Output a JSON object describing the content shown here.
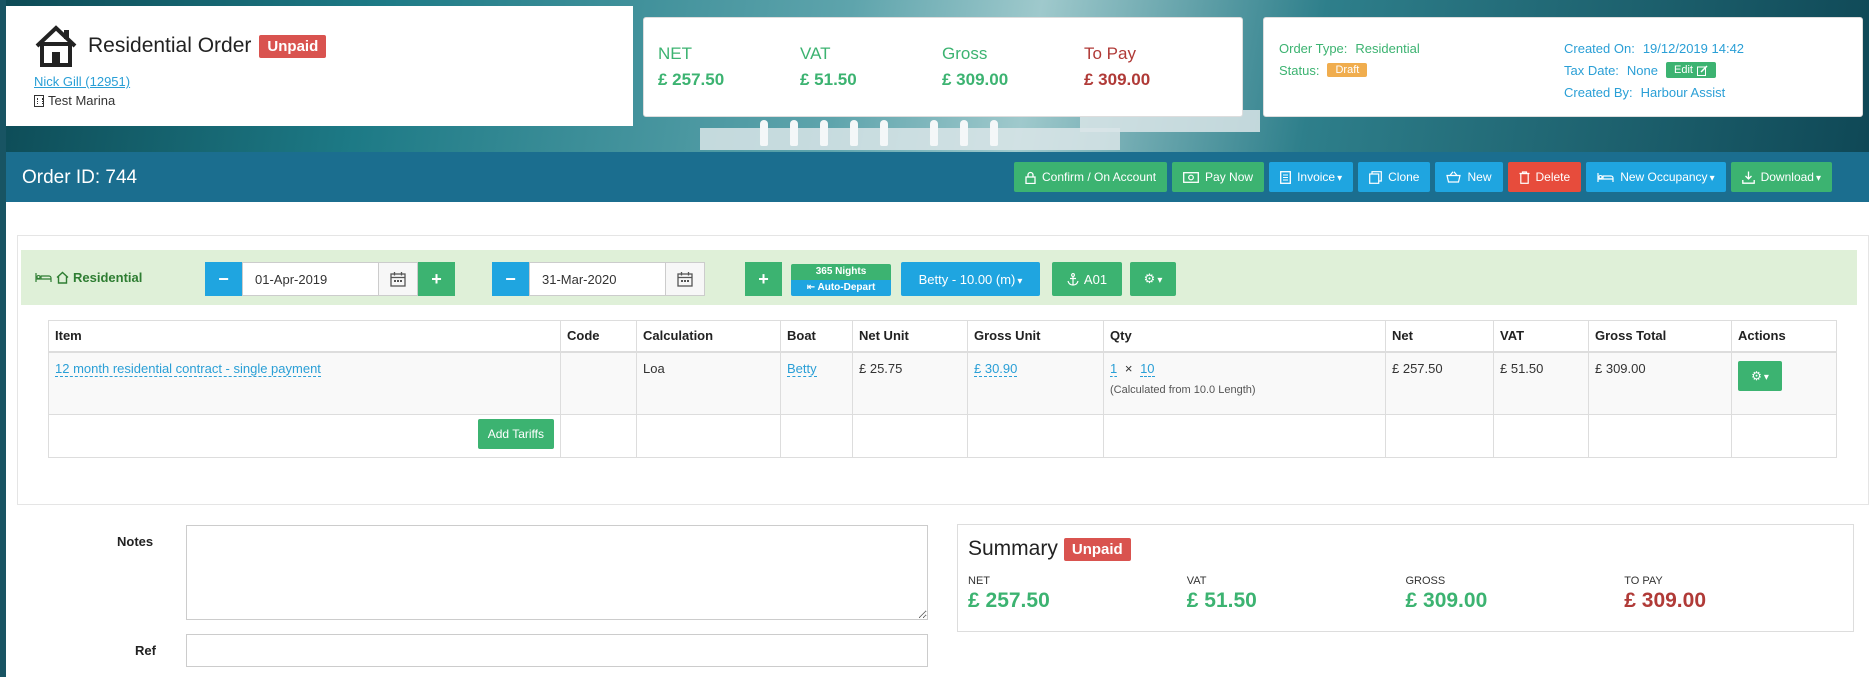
{
  "header": {
    "title": "Residential Order",
    "status_badge": "Unpaid",
    "customer_link": "Nick Gill (12951)",
    "marina": "Test Marina"
  },
  "totals": {
    "net_label": "NET",
    "net_value": "£ 257.50",
    "vat_label": "VAT",
    "vat_value": "£ 51.50",
    "gross_label": "Gross",
    "gross_value": "£ 309.00",
    "topay_label": "To Pay",
    "topay_value": "£ 309.00"
  },
  "meta": {
    "order_type_label": "Order Type:",
    "order_type_value": "Residential",
    "status_label": "Status:",
    "status_value": "Draft",
    "created_on_label": "Created On:",
    "created_on_value": "19/12/2019 14:42",
    "tax_date_label": "Tax Date:",
    "tax_date_value": "None",
    "edit_label": "Edit",
    "created_by_label": "Created By:",
    "created_by_value": "Harbour Assist"
  },
  "order_bar": {
    "order_id": "Order ID: 744",
    "buttons": {
      "confirm": "Confirm / On Account",
      "pay_now": "Pay Now",
      "invoice": "Invoice",
      "clone": "Clone",
      "new": "New",
      "delete": "Delete",
      "new_occupancy": "New Occupancy",
      "download": "Download"
    }
  },
  "booking": {
    "label": "Residential",
    "start_date": "01-Apr-2019",
    "end_date": "31-Mar-2020",
    "nights": "365 Nights",
    "auto_depart": "Auto-Depart",
    "boat_select": "Betty - 10.00 (m)",
    "berth": "A01"
  },
  "table": {
    "headers": [
      "Item",
      "Code",
      "Calculation",
      "Boat",
      "Net Unit",
      "Gross Unit",
      "Qty",
      "Net",
      "VAT",
      "Gross Total",
      "Actions"
    ],
    "rows": [
      {
        "item": "12 month residential contract - single payment",
        "code": "",
        "calculation": "Loa",
        "boat": "Betty",
        "net_unit": "£ 25.75",
        "gross_unit": "£ 30.90",
        "qty_a": "1",
        "qty_x": "×",
        "qty_b": "10",
        "qty_note": "(Calculated from 10.0 Length)",
        "net": "£ 257.50",
        "vat": "£ 51.50",
        "gross_total": "£ 309.00"
      }
    ],
    "add_tariffs": "Add Tariffs"
  },
  "notes": {
    "label": "Notes",
    "value": ""
  },
  "ref": {
    "label": "Ref",
    "value": ""
  },
  "summary": {
    "title": "Summary",
    "badge": "Unpaid",
    "net_label": "NET",
    "net_value": "£ 257.50",
    "vat_label": "VAT",
    "vat_value": "£ 51.50",
    "gross_label": "GROSS",
    "gross_value": "£ 309.00",
    "topay_label": "TO PAY",
    "topay_value": "£ 309.00"
  },
  "colors": {
    "green": "#3cb371",
    "blue": "#1fa5e0",
    "red": "#e74c3c",
    "bar": "#1b6e8f",
    "orange": "#f0ad4e"
  }
}
